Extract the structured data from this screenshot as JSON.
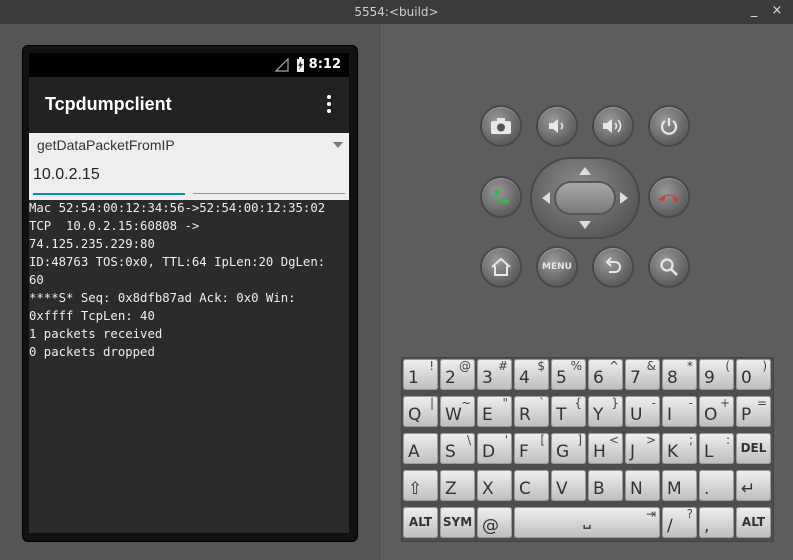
{
  "window": {
    "title": "5554:<build>",
    "minimize": "_",
    "close": "×"
  },
  "status_bar": {
    "time": "8:12"
  },
  "app": {
    "title": "Tcpdumpclient",
    "spinner_value": "getDataPacketFromIP",
    "ip_value": "10.0.2.15",
    "output_lines": [
      "Mac 52:54:00:12:34:56->52:54:00:12:35:02",
      "TCP  10.0.2.15:60808 ->",
      "74.125.235.229:80",
      "ID:48763 TOS:0x0, TTL:64 IpLen:20 DgLen:",
      "60",
      "****S* Seq: 0x8dfb87ad Ack: 0x0 Win:",
      "0xffff TcpLen: 40",
      "1 packets received",
      "0 packets dropped"
    ]
  },
  "controls": {
    "menu_label": "MENU"
  },
  "keyboard": {
    "row1": [
      [
        "1",
        "!"
      ],
      [
        "2",
        "@"
      ],
      [
        "3",
        "#"
      ],
      [
        "4",
        "$"
      ],
      [
        "5",
        "%"
      ],
      [
        "6",
        "^"
      ],
      [
        "7",
        "&"
      ],
      [
        "8",
        "*"
      ],
      [
        "9",
        "("
      ],
      [
        "0",
        ")"
      ]
    ],
    "row2": [
      [
        "Q",
        "|"
      ],
      [
        "W",
        "~"
      ],
      [
        "E",
        "\""
      ],
      [
        "R",
        "`"
      ],
      [
        "T",
        "{"
      ],
      [
        "Y",
        "}"
      ],
      [
        "U",
        "-"
      ],
      [
        "I",
        "-"
      ],
      [
        "O",
        "+"
      ],
      [
        "P",
        "="
      ]
    ],
    "row3": [
      [
        "A",
        ""
      ],
      [
        "S",
        "\\"
      ],
      [
        "D",
        "'"
      ],
      [
        "F",
        "["
      ],
      [
        "G",
        "]"
      ],
      [
        "H",
        "<"
      ],
      [
        "J",
        ">"
      ],
      [
        "K",
        ";"
      ],
      [
        "L",
        ":"
      ],
      [
        "DEL",
        ""
      ]
    ],
    "row4": [
      [
        "⇧",
        ""
      ],
      [
        "Z",
        ""
      ],
      [
        "X",
        ""
      ],
      [
        "C",
        ""
      ],
      [
        "V",
        ""
      ],
      [
        "B",
        ""
      ],
      [
        "N",
        ""
      ],
      [
        "M",
        ""
      ],
      [
        ".",
        ""
      ],
      [
        "↵",
        ""
      ]
    ],
    "row5_alt_left": "ALT",
    "row5_sym": "SYM",
    "row5_at": "@",
    "row5_space": "␣",
    "row5_tab": "⇥",
    "row5_slash": "/",
    "row5_question": "?",
    "row5_comma": ",",
    "row5_alt_right": "ALT"
  }
}
